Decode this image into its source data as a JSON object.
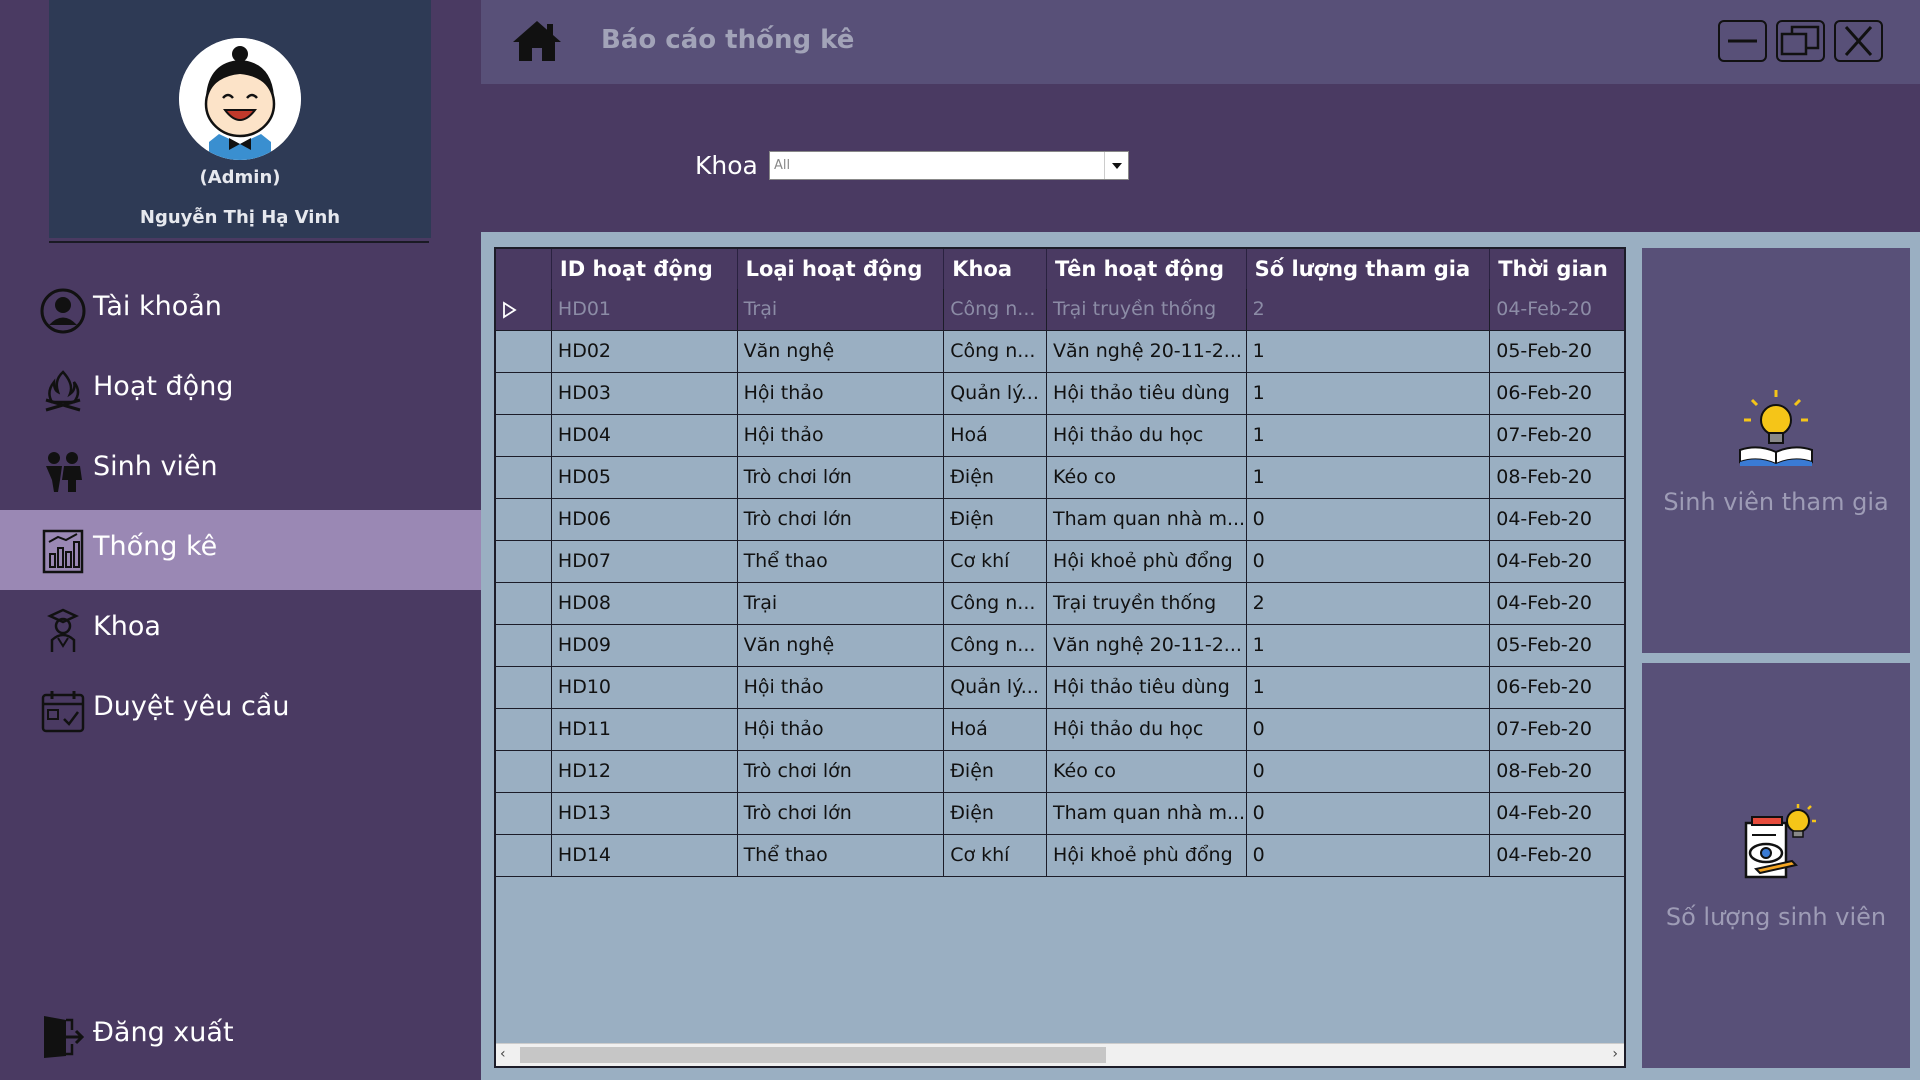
{
  "profile": {
    "role": "(Admin)",
    "name": "Nguyễn Thị Hạ Vinh"
  },
  "nav": {
    "account": "Tài khoản",
    "activities": "Hoạt động",
    "students": "Sinh viên",
    "statistics": "Thống kê",
    "faculty": "Khoa",
    "requests": "Duyệt yêu cầu",
    "logout": "Đăng xuất",
    "active": "statistics"
  },
  "titlebar": {
    "title": "Báo cáo thống kê"
  },
  "filter": {
    "label": "Khoa",
    "value": "All"
  },
  "table": {
    "columns": [
      "ID hoạt động",
      "Loại hoạt động",
      "Khoa",
      "Tên hoạt động",
      "Số lượng tham gia",
      "Thời gian"
    ],
    "rows": [
      [
        "HD01",
        "Trại",
        "Công n...",
        "Trại truyền thống",
        "2",
        "04-Feb-20"
      ],
      [
        "HD02",
        "Văn nghệ",
        "Công n...",
        "Văn nghệ 20-11-2...",
        "1",
        "05-Feb-20"
      ],
      [
        "HD03",
        "Hội thảo",
        "Quản lý...",
        "Hội thảo tiêu dùng",
        "1",
        "06-Feb-20"
      ],
      [
        "HD04",
        "Hội thảo",
        "Hoá",
        "Hội thảo du học",
        "1",
        "07-Feb-20"
      ],
      [
        "HD05",
        "Trò chơi lớn",
        "Điện",
        "Kéo co",
        "1",
        "08-Feb-20"
      ],
      [
        "HD06",
        "Trò chơi lớn",
        "Điện",
        "Tham quan nhà m...",
        "0",
        "04-Feb-20"
      ],
      [
        "HD07",
        "Thể thao",
        "Cơ khí",
        "Hội khoẻ phù đổng",
        "0",
        "04-Feb-20"
      ],
      [
        "HD08",
        "Trại",
        "Công n...",
        "Trại truyền thống",
        "2",
        "04-Feb-20"
      ],
      [
        "HD09",
        "Văn nghệ",
        "Công n...",
        "Văn nghệ 20-11-2...",
        "1",
        "05-Feb-20"
      ],
      [
        "HD10",
        "Hội thảo",
        "Quản lý...",
        "Hội thảo tiêu dùng",
        "1",
        "06-Feb-20"
      ],
      [
        "HD11",
        "Hội thảo",
        "Hoá",
        "Hội thảo du học",
        "0",
        "07-Feb-20"
      ],
      [
        "HD12",
        "Trò chơi lớn",
        "Điện",
        "Kéo co",
        "0",
        "08-Feb-20"
      ],
      [
        "HD13",
        "Trò chơi lớn",
        "Điện",
        "Tham quan nhà m...",
        "0",
        "04-Feb-20"
      ],
      [
        "HD14",
        "Thể thao",
        "Cơ khí",
        "Hội khoẻ phù đổng",
        "0",
        "04-Feb-20"
      ]
    ],
    "selected_row": 0
  },
  "cards": {
    "participants": "Sinh viên tham gia",
    "count": "Số lượng sinh viên"
  },
  "colors": {
    "background": "#4a3a62",
    "titlebar": "#585078",
    "profile": "#2e3a55",
    "active_nav": "#9a88b4",
    "grid": "#9aafc2"
  },
  "icons": {
    "home": "home-icon",
    "minimize": "minimize-icon",
    "maximize": "maximize-icon",
    "close": "close-icon",
    "account": "user-circle-icon",
    "activities": "campfire-icon",
    "students": "students-icon",
    "statistics": "chart-icon",
    "faculty": "graduate-icon",
    "requests": "calendar-check-icon",
    "logout": "logout-door-icon",
    "participants": "lightbulb-book-icon",
    "count": "report-eye-icon"
  }
}
